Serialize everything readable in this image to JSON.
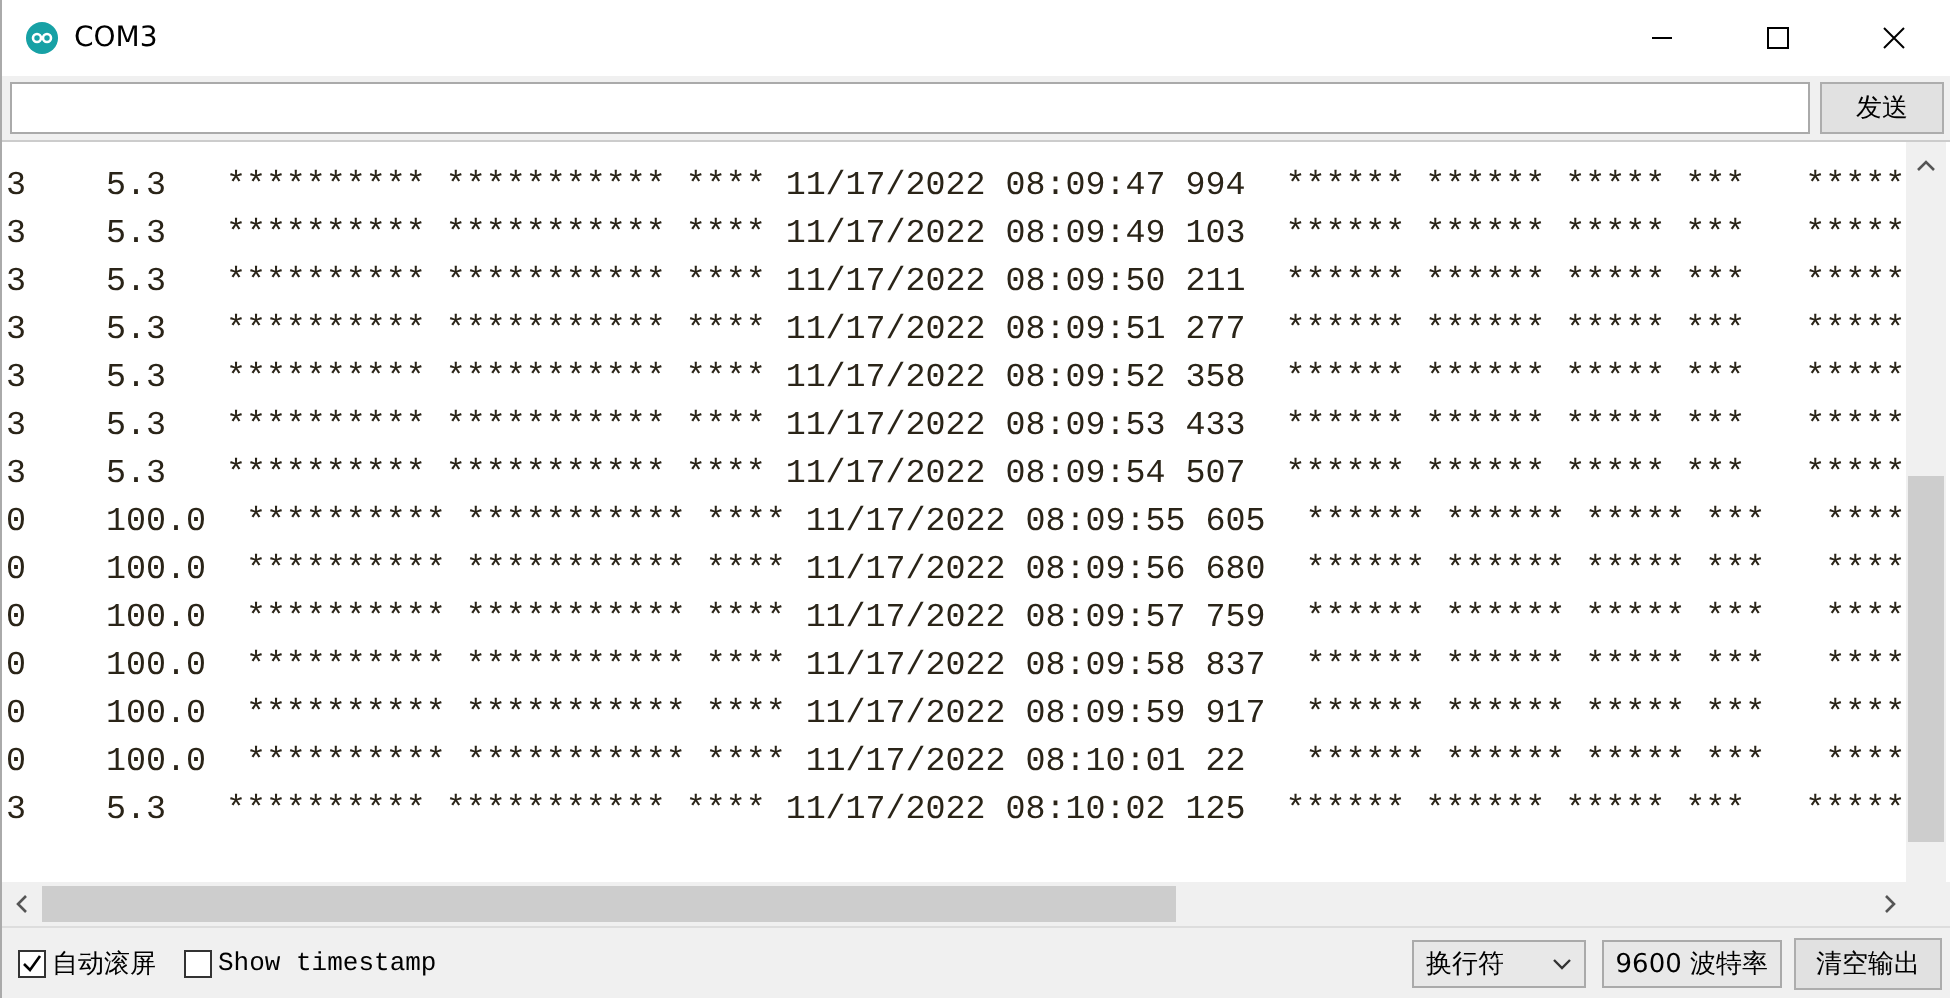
{
  "window": {
    "title": "COM3"
  },
  "send_button": "发送",
  "lines": [
    "3    5.3   ********** *********** **** 11/17/2022 08:09:47 994  ****** ****** ***** ***   *****",
    "3    5.3   ********** *********** **** 11/17/2022 08:09:49 103  ****** ****** ***** ***   *****",
    "3    5.3   ********** *********** **** 11/17/2022 08:09:50 211  ****** ****** ***** ***   *****",
    "3    5.3   ********** *********** **** 11/17/2022 08:09:51 277  ****** ****** ***** ***   *****",
    "3    5.3   ********** *********** **** 11/17/2022 08:09:52 358  ****** ****** ***** ***   *****",
    "3    5.3   ********** *********** **** 11/17/2022 08:09:53 433  ****** ****** ***** ***   *****",
    "3    5.3   ********** *********** **** 11/17/2022 08:09:54 507  ****** ****** ***** ***   *****",
    "0    100.0  ********** *********** **** 11/17/2022 08:09:55 605  ****** ****** ***** ***   ****",
    "0    100.0  ********** *********** **** 11/17/2022 08:09:56 680  ****** ****** ***** ***   ****",
    "0    100.0  ********** *********** **** 11/17/2022 08:09:57 759  ****** ****** ***** ***   ****",
    "0    100.0  ********** *********** **** 11/17/2022 08:09:58 837  ****** ****** ***** ***   ****",
    "0    100.0  ********** *********** **** 11/17/2022 08:09:59 917  ****** ****** ***** ***   ****",
    "0    100.0  ********** *********** **** 11/17/2022 08:10:01 22   ****** ****** ***** ***   ****",
    "3    5.3   ********** *********** **** 11/17/2022 08:10:02 125  ****** ****** ***** ***   *****"
  ],
  "autoscroll": {
    "label": "自动滚屏",
    "checked": true
  },
  "timestamp": {
    "label": "Show timestamp",
    "checked": false
  },
  "line_ending": "换行符",
  "baud_rate": "9600 波特率",
  "clear_button": "清空输出"
}
